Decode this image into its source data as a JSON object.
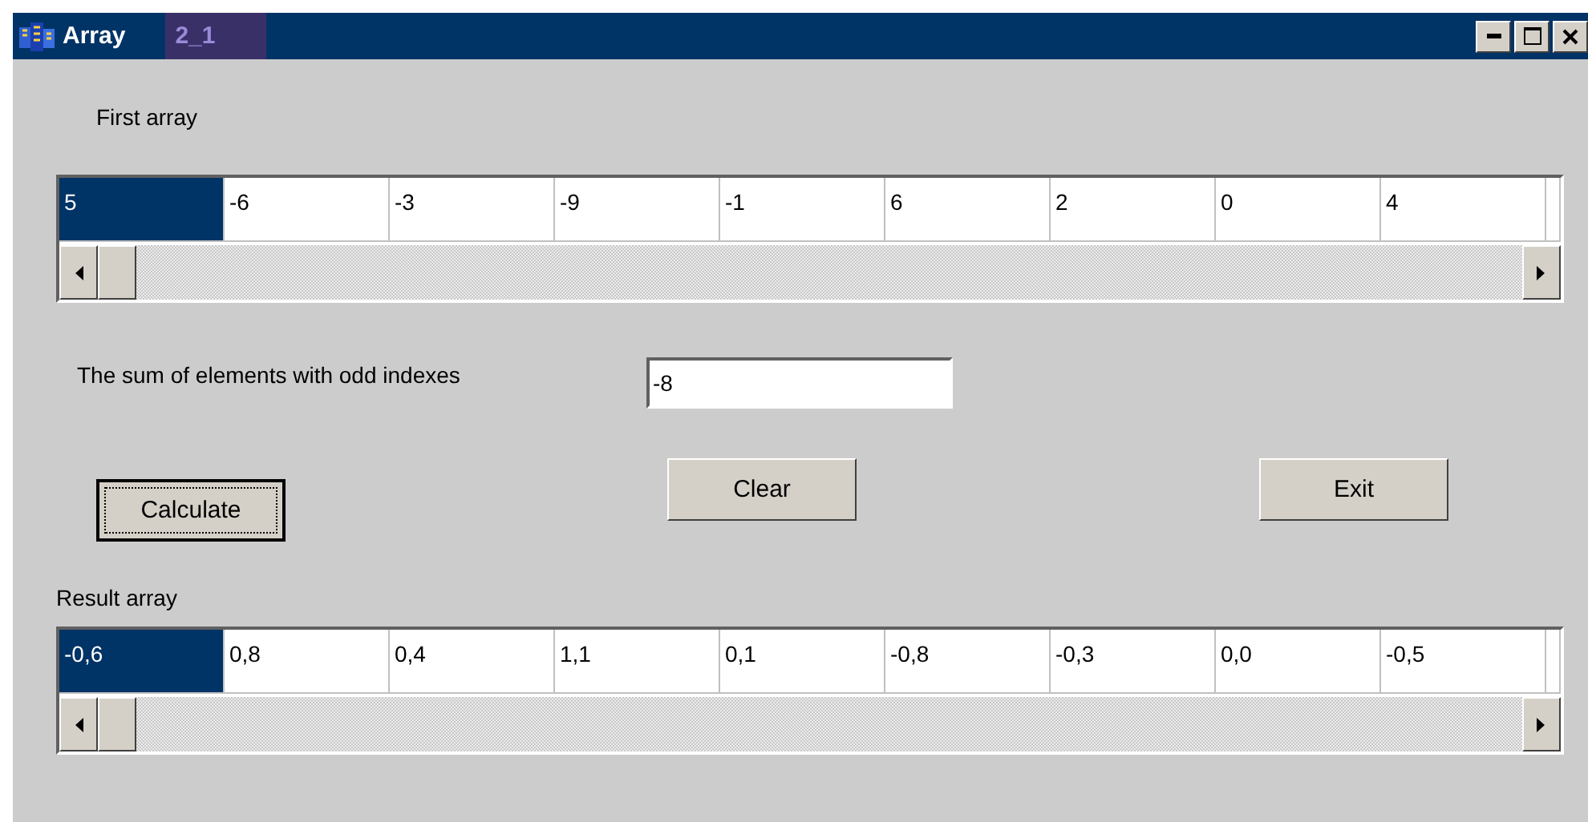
{
  "window": {
    "title": "Array",
    "title_note": "2_1"
  },
  "first_array": {
    "label": "First array",
    "cells": [
      {
        "text": "5",
        "selected": true
      },
      {
        "text": "-6",
        "selected": false
      },
      {
        "text": "-3",
        "selected": false
      },
      {
        "text": "-9",
        "selected": false
      },
      {
        "text": "-1",
        "selected": false
      },
      {
        "text": "6",
        "selected": false
      },
      {
        "text": "2",
        "selected": false
      },
      {
        "text": "0",
        "selected": false
      },
      {
        "text": "4",
        "selected": false
      }
    ]
  },
  "sum": {
    "label": "The sum of elements with odd indexes",
    "value": "-8"
  },
  "buttons": [
    {
      "label": "Calculate",
      "focused": true
    },
    {
      "label": "Clear",
      "focused": false
    },
    {
      "label": "Exit",
      "focused": false
    }
  ],
  "result_array": {
    "label": "Result array",
    "cells": [
      {
        "text": "-0,6",
        "selected": true
      },
      {
        "text": "0,8",
        "selected": false
      },
      {
        "text": "0,4",
        "selected": false
      },
      {
        "text": "1,1",
        "selected": false
      },
      {
        "text": "0,1",
        "selected": false
      },
      {
        "text": "-0,8",
        "selected": false
      },
      {
        "text": "-0,3",
        "selected": false
      },
      {
        "text": "0,0",
        "selected": false
      },
      {
        "text": "-0,5",
        "selected": false
      }
    ]
  }
}
